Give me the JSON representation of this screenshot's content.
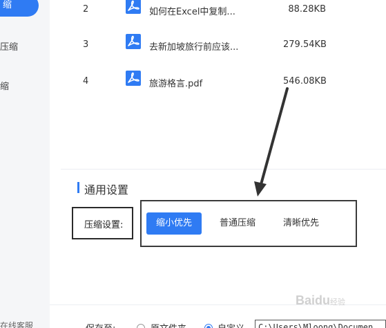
{
  "sidebar": {
    "active_label": "缩",
    "items": [
      {
        "label": "压缩"
      },
      {
        "label": "缩"
      }
    ],
    "footer_label": "在线客服"
  },
  "files": [
    {
      "index": "2",
      "name": "如何在Excel中复制...",
      "size": "88.28KB"
    },
    {
      "index": "3",
      "name": "去新加坡旅行前应该...",
      "size": "279.54KB"
    },
    {
      "index": "4",
      "name": "旅游格言.pdf",
      "size": "546.08KB"
    }
  ],
  "settings": {
    "section_title": "通用设置",
    "compress_label": "压缩设置:",
    "options": [
      {
        "label": "缩小优先",
        "selected": true
      },
      {
        "label": "普通压缩",
        "selected": false
      },
      {
        "label": "清晰优先",
        "selected": false
      }
    ]
  },
  "save": {
    "label": "保存至:",
    "option_original": "原文件夹",
    "option_custom": "自定义",
    "path_value": "C:\\Users\\Mloong\\Documen"
  },
  "watermark": {
    "text": "Baidu",
    "sub": "经验"
  },
  "colors": {
    "accent": "#2f7bf3",
    "sidebar_bg": "#f5f6f8",
    "annotation": "#333333"
  }
}
